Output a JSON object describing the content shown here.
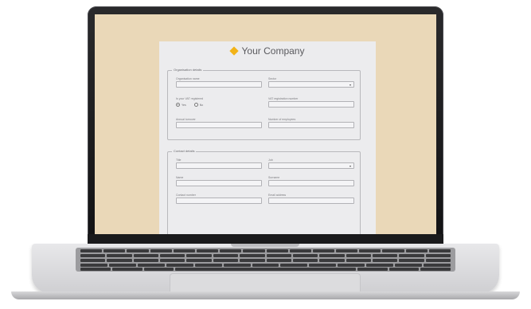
{
  "form": {
    "company_name": "Your Company",
    "logo_icon": "diamond-logo-icon",
    "logo_color": "#f2b318",
    "organisation": {
      "legend": "Organisation details",
      "organisation_name_label": "Organisation name",
      "sector_label": "Sector",
      "vat_registered_label": "Is your VAT registered",
      "vat_yes": "Yes",
      "vat_no": "No",
      "vat_number_label": "VAT registration number",
      "annual_turnover_label": "Annual turnover",
      "employees_label": "Number of employees"
    },
    "contact": {
      "legend": "Contact details",
      "field_a_label": "Title",
      "field_b_label": "Job",
      "name_label": "Name",
      "surname_label": "Surname",
      "contact_number_label": "Contact number",
      "email_label": "Email address"
    }
  },
  "colors": {
    "screen_background": "#ead8b8",
    "sheet": "#ececee"
  }
}
